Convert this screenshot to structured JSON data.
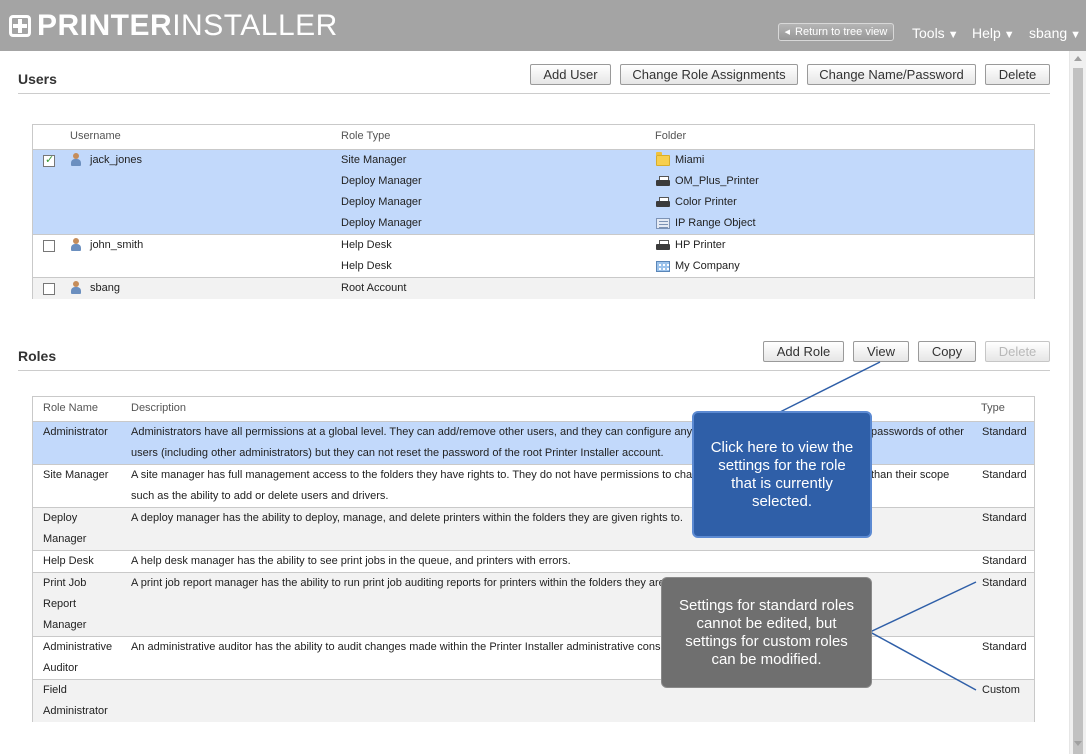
{
  "header": {
    "logo_bold": "PRINTER",
    "logo_light": "INSTALLER",
    "return_label": "Return to tree view",
    "menus": [
      {
        "label": "Tools"
      },
      {
        "label": "Help"
      },
      {
        "label": "sbang"
      }
    ]
  },
  "users": {
    "title": "Users",
    "buttons": {
      "add": "Add User",
      "change_roles": "Change Role Assignments",
      "change_name": "Change Name/Password",
      "delete": "Delete"
    },
    "columns": {
      "username": "Username",
      "role_type": "Role Type",
      "folder": "Folder"
    },
    "rows": [
      {
        "username": "jack_jones",
        "checked": true,
        "assignments": [
          {
            "role": "Site Manager",
            "folder": "Miami",
            "icon": "folder-icon"
          },
          {
            "role": "Deploy Manager",
            "folder": "OM_Plus_Printer",
            "icon": "printer-icon"
          },
          {
            "role": "Deploy Manager",
            "folder": "Color Printer",
            "icon": "printer-icon"
          },
          {
            "role": "Deploy Manager",
            "folder": "IP Range Object",
            "icon": "ip-range-icon"
          }
        ]
      },
      {
        "username": "john_smith",
        "checked": false,
        "assignments": [
          {
            "role": "Help Desk",
            "folder": "HP Printer",
            "icon": "printer-icon"
          },
          {
            "role": "Help Desk",
            "folder": "My Company",
            "icon": "company-icon"
          }
        ]
      },
      {
        "username": "sbang",
        "checked": false,
        "assignments": [
          {
            "role": "Root Account",
            "folder": "",
            "icon": ""
          }
        ]
      }
    ]
  },
  "roles": {
    "title": "Roles",
    "buttons": {
      "add": "Add Role",
      "view": "View",
      "copy": "Copy",
      "delete": "Delete"
    },
    "columns": {
      "name": "Role Name",
      "description": "Description",
      "type": "Type"
    },
    "rows": [
      {
        "name": "Administrator",
        "description_lines": [
          "Administrators have all permissions at a global level. They can add/remove other users, and they can configure any se",
          "users (including other administrators) but they can not reset the password of the root Printer Installer account."
        ],
        "description_tail": "passwords of other",
        "type": "Standard"
      },
      {
        "name": "Site Manager",
        "description_lines": [
          "A site manager has full management access to the folders they have rights to. They do not have permissions to chang",
          "such as the ability to add or delete users and drivers."
        ],
        "description_tail": "than their scope",
        "type": "Standard"
      },
      {
        "name_lines": [
          "Deploy",
          "Manager"
        ],
        "description_lines": [
          "A deploy manager has the ability to deploy, manage, and delete printers within the folders they are given rights to."
        ],
        "type": "Standard"
      },
      {
        "name": "Help Desk",
        "description_lines": [
          "A help desk manager has the ability to see print jobs in the queue, and printers with errors."
        ],
        "type": "Standard"
      },
      {
        "name_lines": [
          "Print Job",
          "Report",
          "Manager"
        ],
        "description_lines": [
          "A print job report manager has the ability to run print job auditing reports for printers within the folders they are gi"
        ],
        "type": "Standard"
      },
      {
        "name_lines": [
          "Administrative",
          "Auditor"
        ],
        "description_lines": [
          "An administrative auditor has the ability to audit changes made within the Printer Installer administrative console"
        ],
        "type": "Standard"
      },
      {
        "name_lines": [
          "Field",
          "Administrator"
        ],
        "description_lines": [
          ""
        ],
        "type": "Custom"
      }
    ]
  },
  "callouts": {
    "view_hint": "Click here to view the settings for the role that is currently selected.",
    "standard_hint": "Settings for standard roles cannot be edited, but settings for custom roles can be modified."
  },
  "colors": {
    "header_bg": "#a4a4a4",
    "selected_row": "#c2d9fb",
    "callout_blue": "#2f5fa8",
    "callout_gray": "#6f6f6f"
  }
}
